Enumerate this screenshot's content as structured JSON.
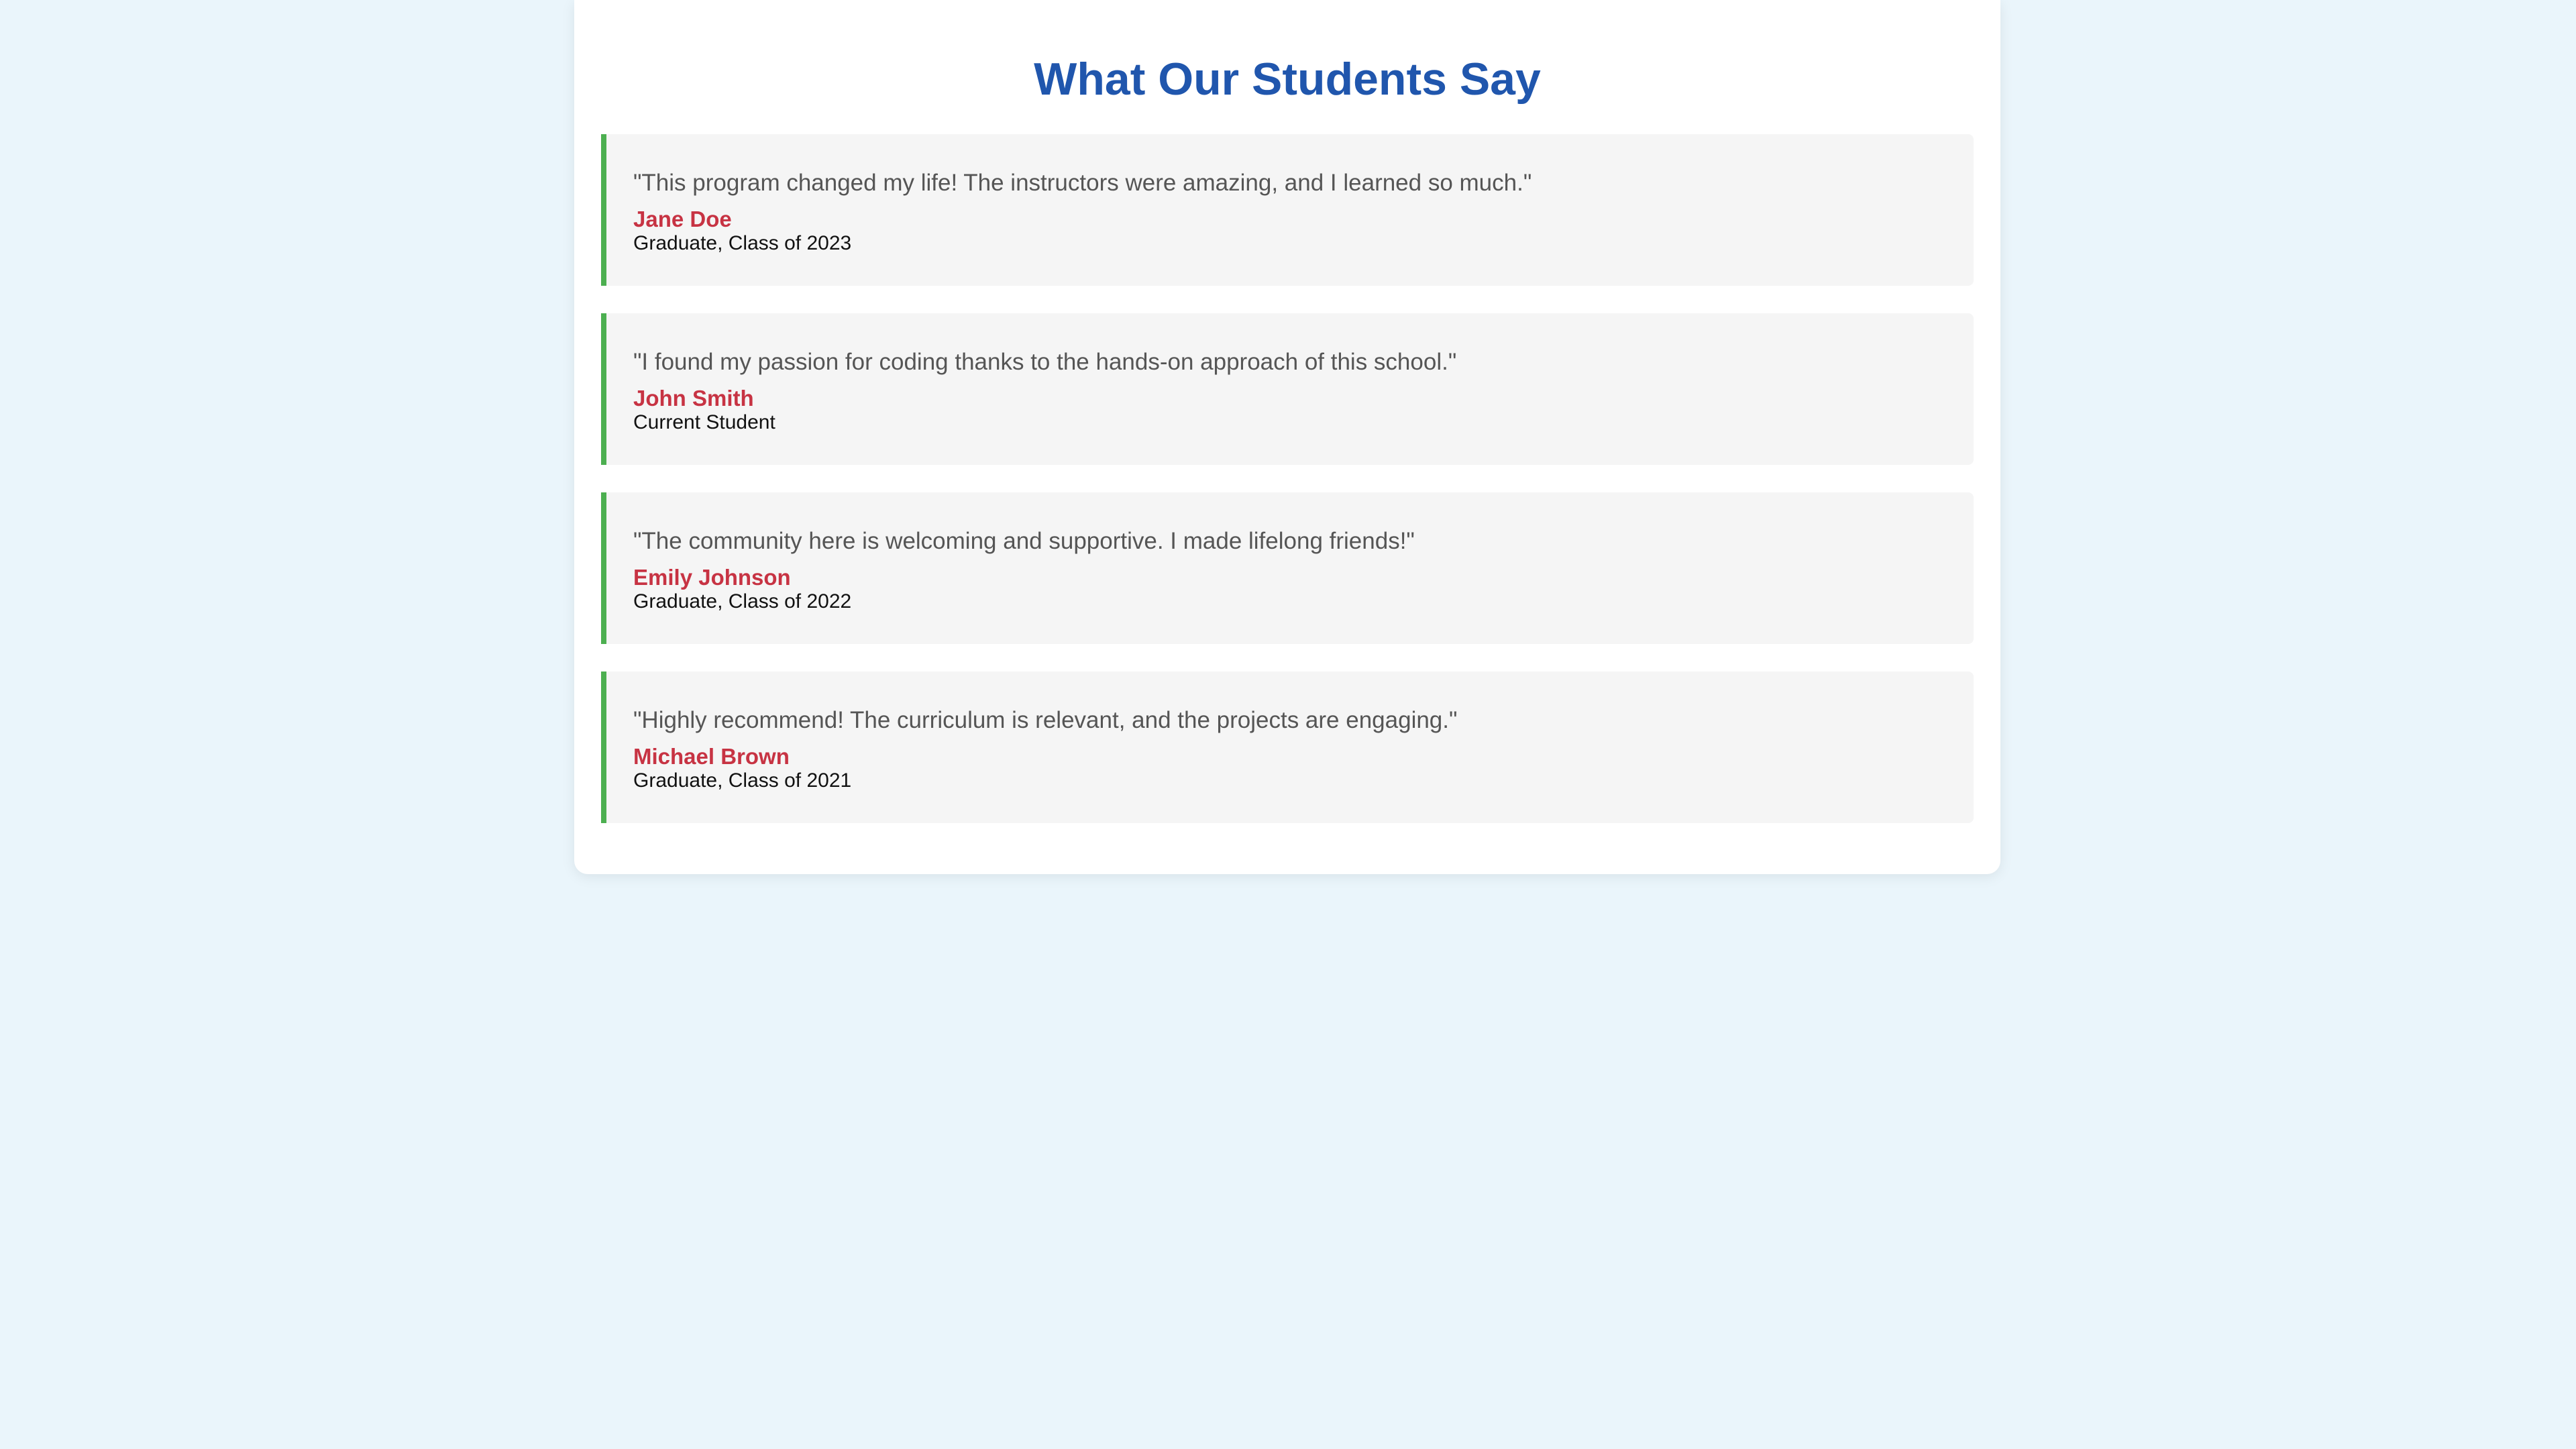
{
  "page": {
    "title": "What Our Students Say"
  },
  "testimonials": [
    {
      "quote": "\"This program changed my life! The instructors were amazing, and I learned so much.\"",
      "author": "Jane Doe",
      "role": "Graduate, Class of 2023"
    },
    {
      "quote": "\"I found my passion for coding thanks to the hands-on approach of this school.\"",
      "author": "John Smith",
      "role": "Current Student"
    },
    {
      "quote": "\"The community here is welcoming and supportive. I made lifelong friends!\"",
      "author": "Emily Johnson",
      "role": "Graduate, Class of 2022"
    },
    {
      "quote": "\"Highly recommend! The curriculum is relevant, and the projects are engaging.\"",
      "author": "Michael Brown",
      "role": "Graduate, Class of 2021"
    }
  ],
  "colors": {
    "background": "#eaf5fb",
    "card": "#ffffff",
    "title": "#2056ad",
    "accent_border": "#4caf50",
    "author": "#c73343",
    "quote": "#555555"
  }
}
